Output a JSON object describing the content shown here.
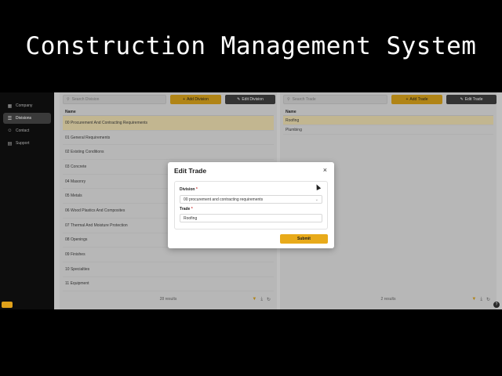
{
  "banner": {
    "title": "Construction Management System"
  },
  "sidebar": {
    "items": [
      {
        "label": "Company",
        "icon": "building-icon",
        "active": false
      },
      {
        "label": "Divisions",
        "icon": "layers-icon",
        "active": true
      },
      {
        "label": "Contact",
        "icon": "people-icon",
        "active": false
      },
      {
        "label": "Support",
        "icon": "support-icon",
        "active": false
      }
    ]
  },
  "divisions_panel": {
    "search_placeholder": "Search Division",
    "add_label": "Add Division",
    "edit_label": "Edit Division",
    "column_header": "Name",
    "rows": [
      "00 Procurement And Contracting Requirements",
      "01 General Requirements",
      "02 Existing Conditions",
      "03 Concrete",
      "04 Masonry",
      "05 Metals",
      "06 Wood Plastics And Composites",
      "07 Thermal And Moisture Protection",
      "08 Openings",
      "09 Finishes",
      "10 Specialties",
      "11 Equipment"
    ],
    "selected_index": 0,
    "results": "28 results"
  },
  "trades_panel": {
    "search_placeholder": "Search Trade",
    "add_label": "Add Trade",
    "edit_label": "Edit Trade",
    "column_header": "Name",
    "rows": [
      "Roofing",
      "Plumbing"
    ],
    "selected_index": 0,
    "results": "2 results"
  },
  "modal": {
    "title": "Edit Trade",
    "division_label": "Division",
    "division_value": "00 procurement and contracting requirements",
    "trade_label": "Trade",
    "trade_value": "Roofing",
    "required_mark": "*",
    "submit_label": "Submit"
  },
  "colors": {
    "accent": "#e8aa1a",
    "sidebar_bg": "#0d0d0d",
    "dark_button": "#333333"
  }
}
